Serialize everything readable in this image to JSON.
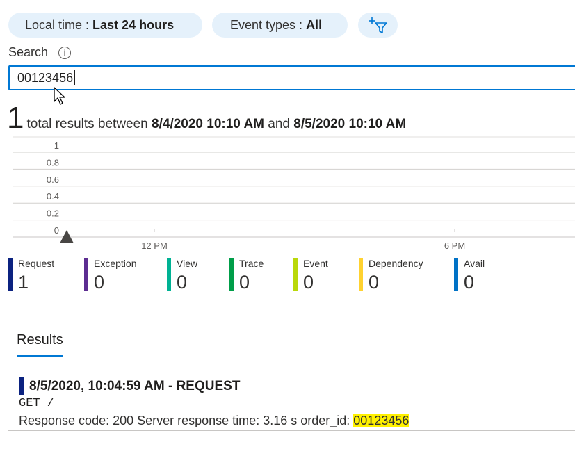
{
  "filters": {
    "time_prefix": "Local time : ",
    "time_value": "Last 24 hours",
    "events_prefix": "Event types : ",
    "events_value": "All"
  },
  "search": {
    "label": "Search",
    "value": "00123456"
  },
  "summary": {
    "count": "1",
    "text_before": "total results between ",
    "start": "8/4/2020 10:10 AM",
    "text_mid": " and ",
    "end": "8/5/2020 10:10 AM"
  },
  "chart_data": {
    "type": "bar",
    "y_ticks": [
      "1",
      "0.8",
      "0.6",
      "0.4",
      "0.2",
      "0"
    ],
    "ylim": [
      0,
      1
    ],
    "x_ticks": [
      "12 PM",
      "6 PM"
    ],
    "grid": true,
    "values": [
      0
    ],
    "marker": "current-time marker near start of range"
  },
  "legend": [
    {
      "name": "Request",
      "count": "1",
      "color": "#0b2280"
    },
    {
      "name": "Exception",
      "count": "0",
      "color": "#5c2d91"
    },
    {
      "name": "View",
      "count": "0",
      "color": "#00b294"
    },
    {
      "name": "Trace",
      "count": "0",
      "color": "#009e49"
    },
    {
      "name": "Event",
      "count": "0",
      "color": "#bad80a"
    },
    {
      "name": "Dependency",
      "count": "0",
      "color": "#ffd230"
    },
    {
      "name": "Avail",
      "count": "0",
      "color": "#0072c6"
    }
  ],
  "results": {
    "tab_label": "Results",
    "items": [
      {
        "title": "8/5/2020, 10:04:59 AM - REQUEST",
        "method_line": "GET /",
        "response_label": "Response code: 200 Server response time: 3.16 s order_id: ",
        "order_id": "00123456"
      }
    ]
  },
  "colors": {
    "accent": "#0078d4",
    "pill_bg": "#e5f1fb",
    "highlight": "#fff100"
  }
}
